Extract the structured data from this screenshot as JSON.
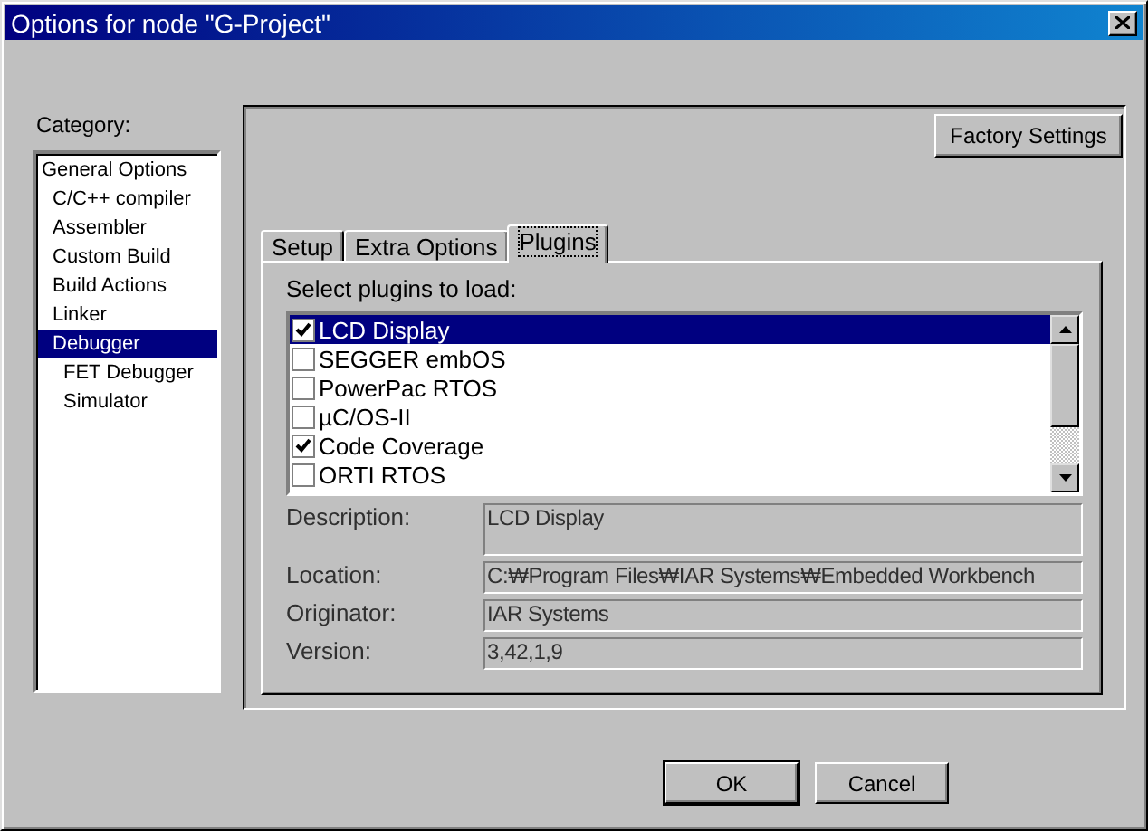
{
  "window": {
    "title": "Options for node \"G-Project\""
  },
  "category": {
    "label": "Category:",
    "tree": [
      {
        "label": "General Options",
        "selected": false,
        "children": [
          {
            "label": "C/C++ compiler",
            "selected": false
          },
          {
            "label": "Assembler",
            "selected": false
          },
          {
            "label": "Custom Build",
            "selected": false
          },
          {
            "label": "Build Actions",
            "selected": false
          },
          {
            "label": "Linker",
            "selected": false
          },
          {
            "label": "Debugger",
            "selected": true,
            "children": [
              {
                "label": "FET Debugger",
                "selected": false
              },
              {
                "label": "Simulator",
                "selected": false
              }
            ]
          }
        ]
      }
    ]
  },
  "factory_settings_button": "Factory Settings",
  "tabs": [
    {
      "label": "Setup",
      "selected": false
    },
    {
      "label": "Extra Options",
      "selected": false
    },
    {
      "label": "Plugins",
      "selected": true
    }
  ],
  "plugins": {
    "label": "Select plugins to load:",
    "items": [
      {
        "name": "LCD Display",
        "checked": true,
        "selected": true
      },
      {
        "name": "SEGGER embOS",
        "checked": false,
        "selected": false
      },
      {
        "name": "PowerPac RTOS",
        "checked": false,
        "selected": false
      },
      {
        "name": "µC/OS-II",
        "checked": false,
        "selected": false
      },
      {
        "name": "Code Coverage",
        "checked": true,
        "selected": false
      },
      {
        "name": "ORTI RTOS",
        "checked": false,
        "selected": false
      }
    ]
  },
  "details": [
    {
      "label": "Description:",
      "value": "LCD Display",
      "kind": "multiline"
    },
    {
      "label": "Location:",
      "value": "C:₩Program Files₩IAR Systems₩Embedded Workbench",
      "kind": "line"
    },
    {
      "label": "Originator:",
      "value": "IAR Systems",
      "kind": "line"
    },
    {
      "label": "Version:",
      "value": "3,42,1,9",
      "kind": "line"
    }
  ],
  "buttons": [
    "OK",
    "Cancel"
  ]
}
